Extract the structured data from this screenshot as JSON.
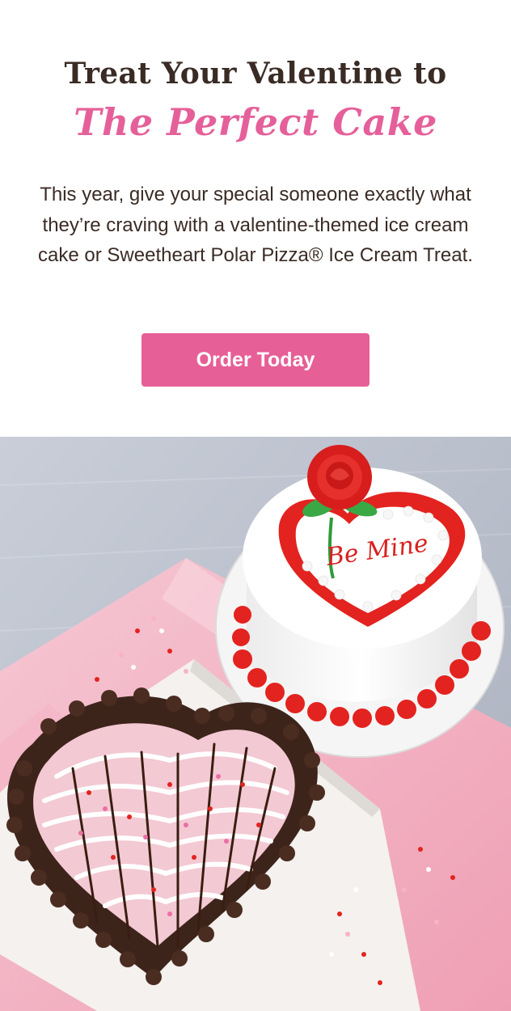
{
  "hero": {
    "headline": "Treat Your Valentine to",
    "script_title": "The Perfect Cake",
    "body": "This year, give your special someone exactly what they’re craving with a valentine-themed ice cream cake or Sweetheart Polar Pizza® Ice Cream Treat.",
    "cta_label": "Order Today"
  },
  "photo": {
    "cake_message": "Be Mine"
  },
  "colors": {
    "brand_pink": "#e65f97",
    "heading_brown": "#3a2b25",
    "frosting_red": "#e3231f"
  }
}
